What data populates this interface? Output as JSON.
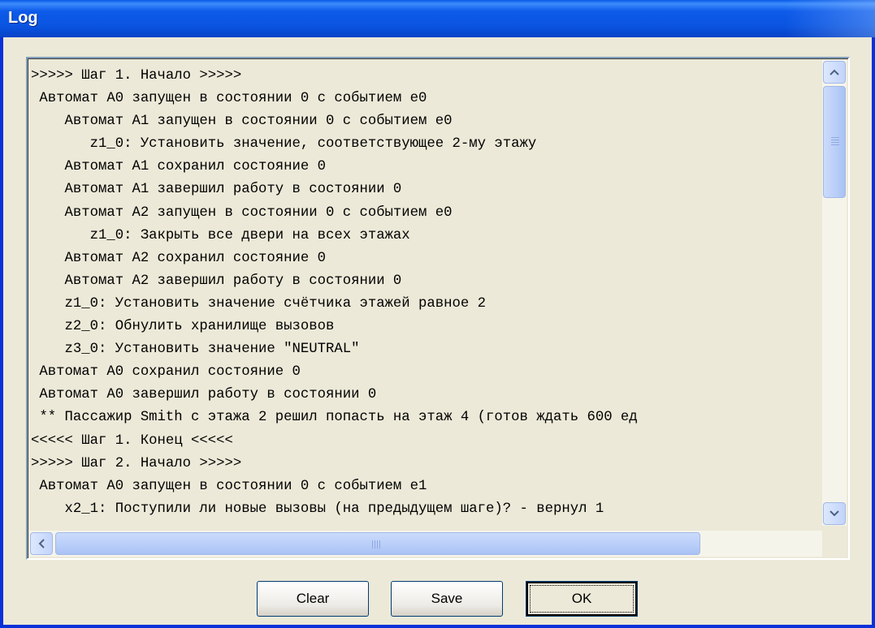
{
  "window": {
    "title": "Log"
  },
  "log": {
    "lines": [
      ">>>>> Шаг 1. Начало >>>>>",
      " Автомат A0 запущен в состоянии 0 с событием e0",
      "    Автомат A1 запущен в состоянии 0 с событием e0",
      "       z1_0: Установить значение, соответствующее 2-му этажу",
      "    Автомат A1 сохранил состояние 0",
      "    Автомат A1 завершил работу в состоянии 0",
      "    Автомат A2 запущен в состоянии 0 с событием e0",
      "       z1_0: Закрыть все двери на всех этажах",
      "    Автомат A2 сохранил состояние 0",
      "    Автомат A2 завершил работу в состоянии 0",
      "    z1_0: Установить значение счётчика этажей равное 2",
      "    z2_0: Обнулить хранилище вызовов",
      "    z3_0: Установить значение \"NEUTRAL\"",
      " Автомат A0 сохранил состояние 0",
      " Автомат A0 завершил работу в состоянии 0",
      " ** Пассажир Smith с этажа 2 решил попасть на этаж 4 (готов ждать 600 ед",
      "<<<<< Шаг 1. Конец <<<<<",
      ">>>>> Шаг 2. Начало >>>>>",
      " Автомат A0 запущен в состоянии 0 с событием e1",
      "    x2_1: Поступили ли новые вызовы (на предыдущем шаге)? - вернул 1"
    ]
  },
  "buttons": {
    "clear": "Clear",
    "save": "Save",
    "ok": "OK"
  },
  "colors": {
    "titlebar": "#0a54e0",
    "face": "#ece9d8",
    "scroll_thumb": "#b8cdf8"
  }
}
